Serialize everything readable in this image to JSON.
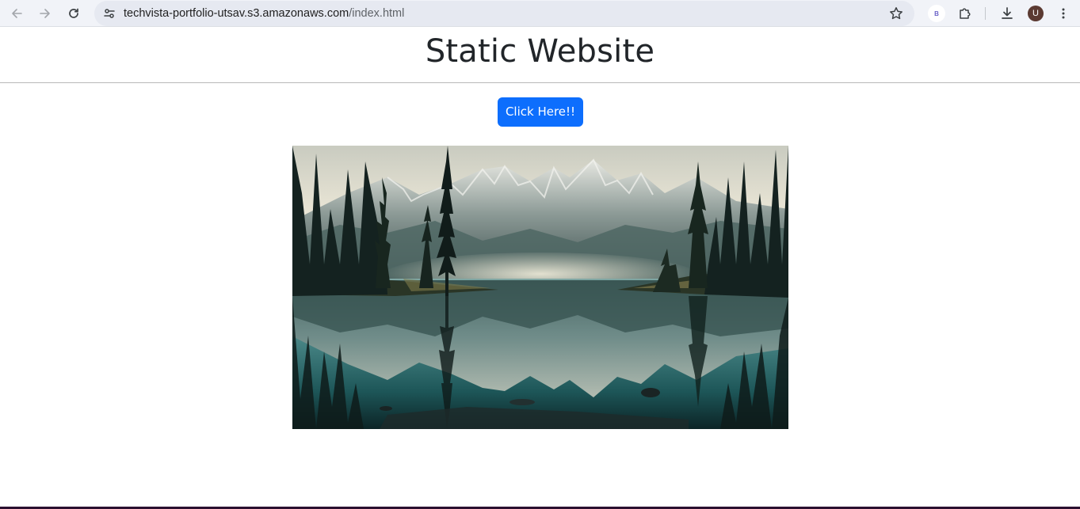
{
  "browser": {
    "url_host": "techvista-portfolio-utsav.s3.amazonaws.com",
    "url_path": "/index.html",
    "extension_badge": "B",
    "profile_initial": "U",
    "icons": {
      "back": "arrow-left-icon",
      "forward": "arrow-right-icon",
      "reload": "reload-icon",
      "site_info": "tune-icon",
      "bookmark": "star-icon",
      "extensions": "puzzle-icon",
      "downloads": "download-icon",
      "menu": "kebab-menu-icon"
    }
  },
  "page": {
    "title": "Static Website",
    "button_label": "Click Here!!",
    "image": "mountain-lake-forest-reflection"
  },
  "colors": {
    "button": "#0d6efd",
    "title": "#212529",
    "toolbar": "#f1f3f8",
    "omnibox": "#e6e9f1",
    "avatar": "#5b3a32"
  }
}
